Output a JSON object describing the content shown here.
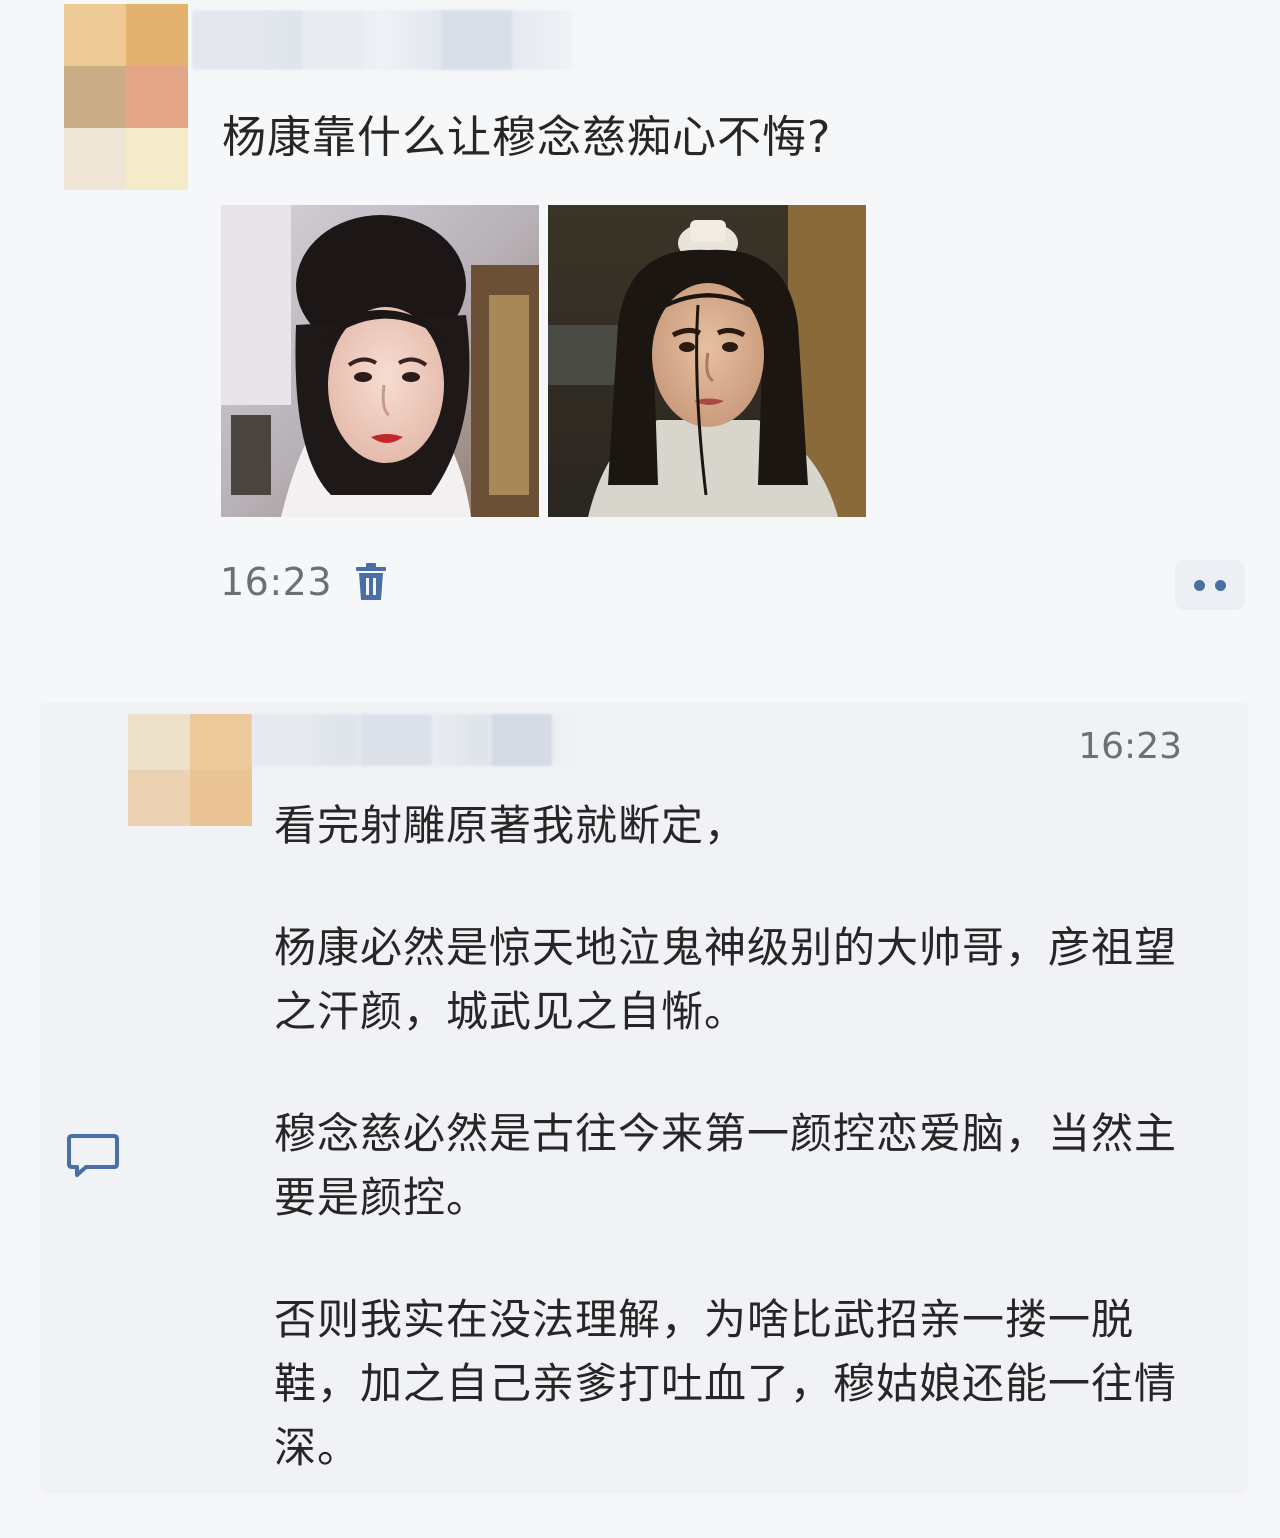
{
  "post": {
    "title": "杨康靠什么让穆念慈痴心不悔?",
    "time": "16:23",
    "icons": {
      "delete": "trash-icon",
      "more": "more-dots-icon"
    },
    "colors": {
      "accent": "#4a6fa5",
      "meta_text": "#6b6f76"
    }
  },
  "comment": {
    "time": "16:23",
    "icons": {
      "reply": "chat-bubble-icon"
    },
    "paragraphs": [
      "看完射雕原著我就断定，",
      "杨康必然是惊天地泣鬼神级别的大帅哥，彦祖望之汗颜，城武见之自惭。",
      "穆念慈必然是古往今来第一颜控恋爱脑，当然主要是颜控。",
      "否则我实在没法理解，为啥比武招亲一搂一脱鞋，加之自己亲爹打吐血了，穆姑娘还能一往情深。"
    ]
  }
}
